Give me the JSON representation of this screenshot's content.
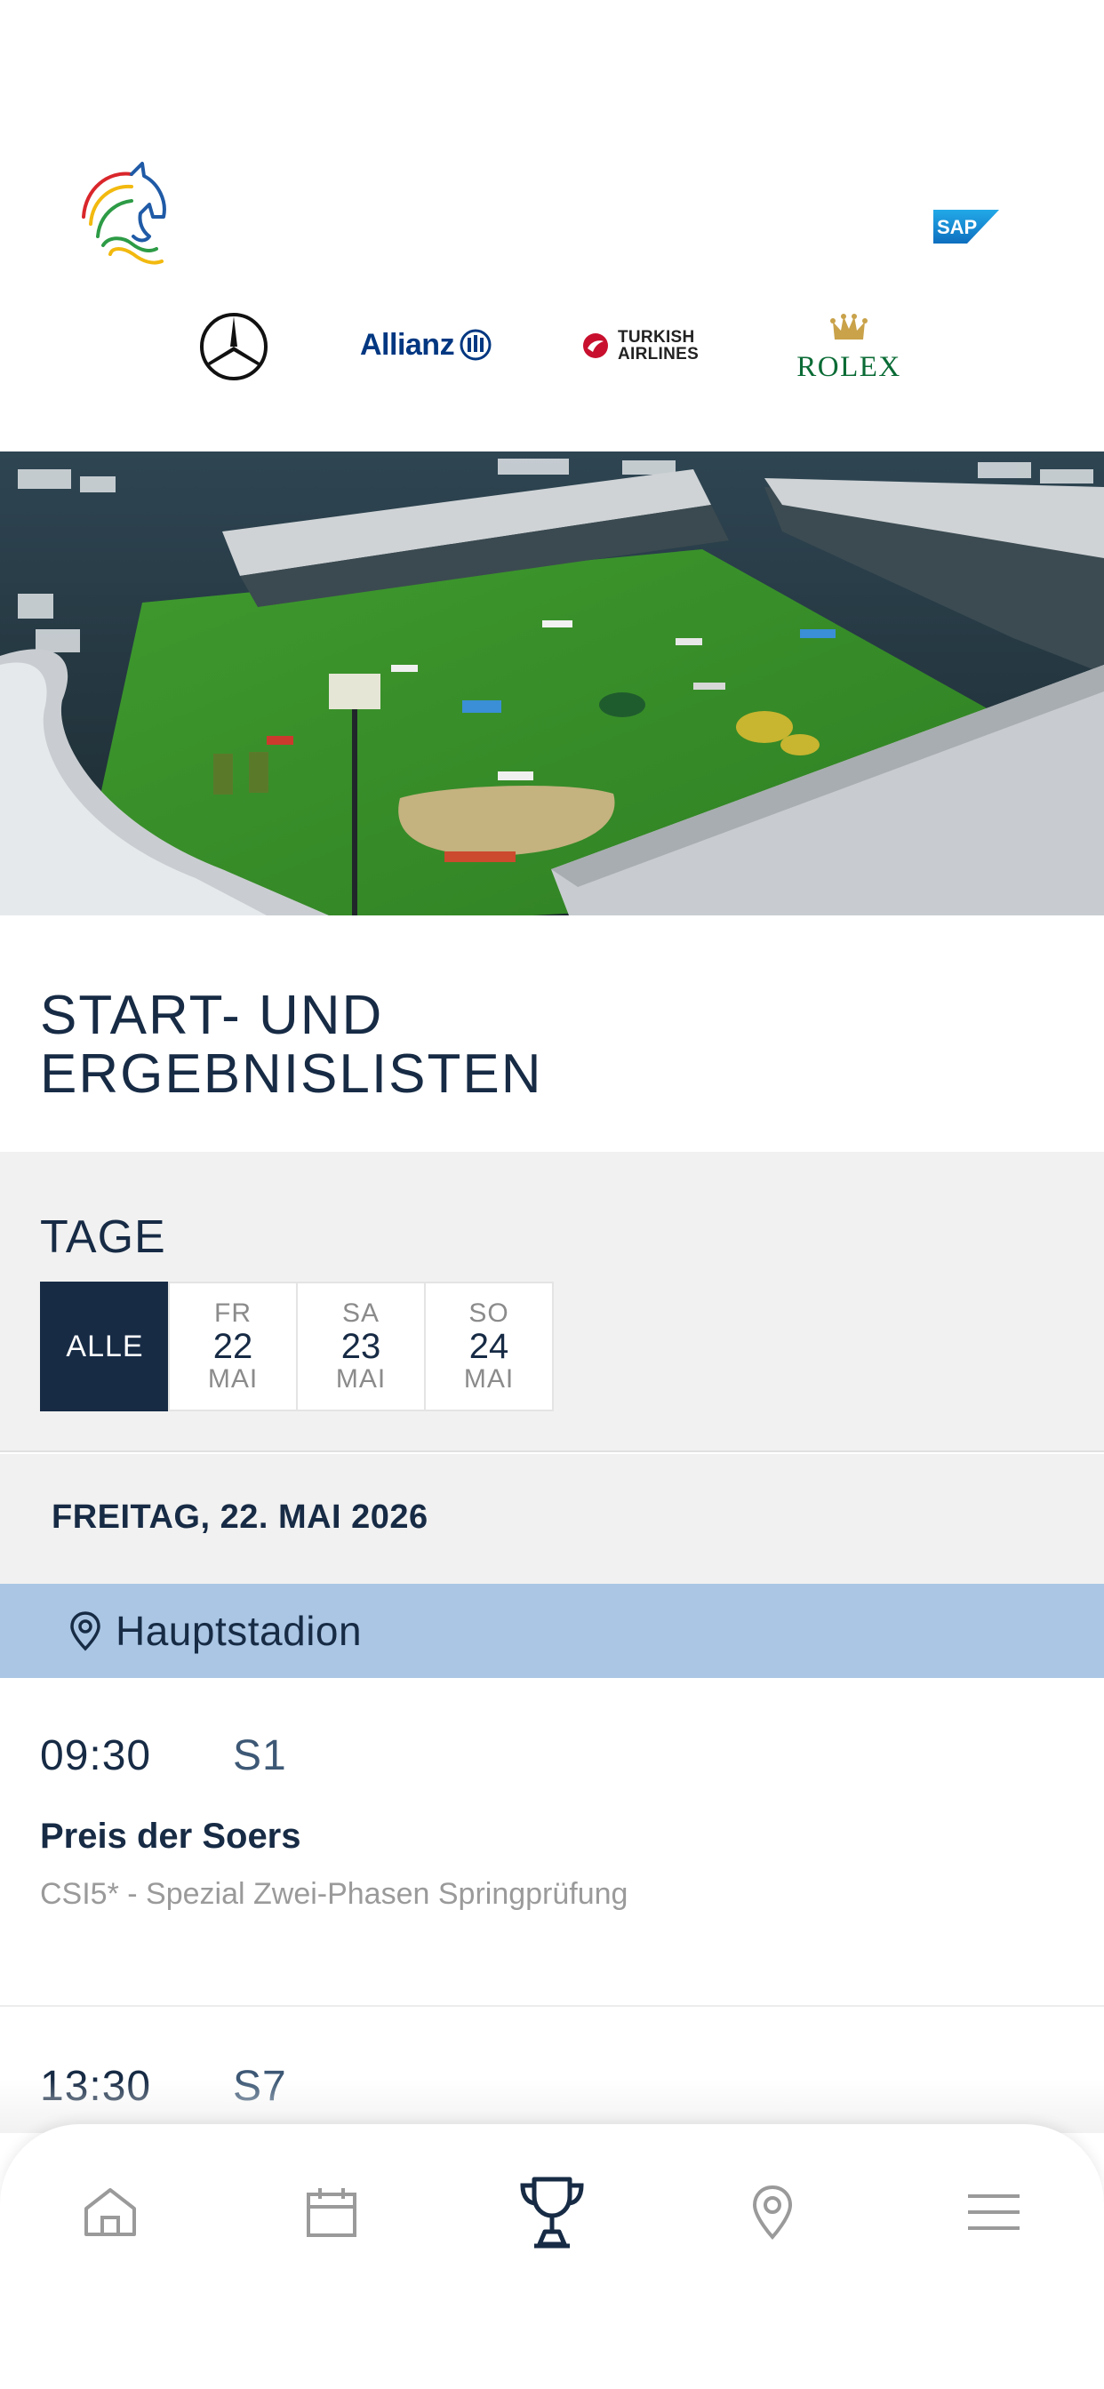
{
  "sponsors": {
    "logos": [
      "horse-logo-icon",
      "sap-logo",
      "mercedes-logo",
      "allianz-logo",
      "turkish-airlines-logo",
      "rolex-logo"
    ],
    "sap_text": "SAP",
    "allianz_text": "Allianz",
    "turkish_line1": "TURKISH",
    "turkish_line2": "AIRLINES",
    "rolex_text": "ROLEX"
  },
  "hero": {
    "image": "aerial stadium photo"
  },
  "page_title": "START- UND\nERGEBNISLISTEN",
  "days": {
    "title": "TAGE",
    "tabs": [
      {
        "all_label": "ALLE",
        "active": true
      },
      {
        "weekday": "FR",
        "day": "22",
        "month": "MAI"
      },
      {
        "weekday": "SA",
        "day": "23",
        "month": "MAI"
      },
      {
        "weekday": "SO",
        "day": "24",
        "month": "MAI"
      }
    ]
  },
  "date_header": "FREITAG, 22. MAI 2026",
  "location": {
    "label": "Hauptstadion",
    "icon": "location-pin-icon"
  },
  "events": [
    {
      "time": "09:30",
      "code": "S1",
      "name": "Preis der Soers",
      "description": "CSI5* - Spezial Zwei-Phasen Springprüfung"
    },
    {
      "time": "13:30",
      "code": "S7"
    }
  ],
  "nav": {
    "items": [
      "home-icon",
      "calendar-icon",
      "trophy-icon",
      "location-pin-icon",
      "menu-icon"
    ],
    "active": "trophy-icon"
  },
  "colors": {
    "navy": "#172b45",
    "location_bar": "#aac6e4",
    "grey_bg": "#f1f1f1"
  }
}
